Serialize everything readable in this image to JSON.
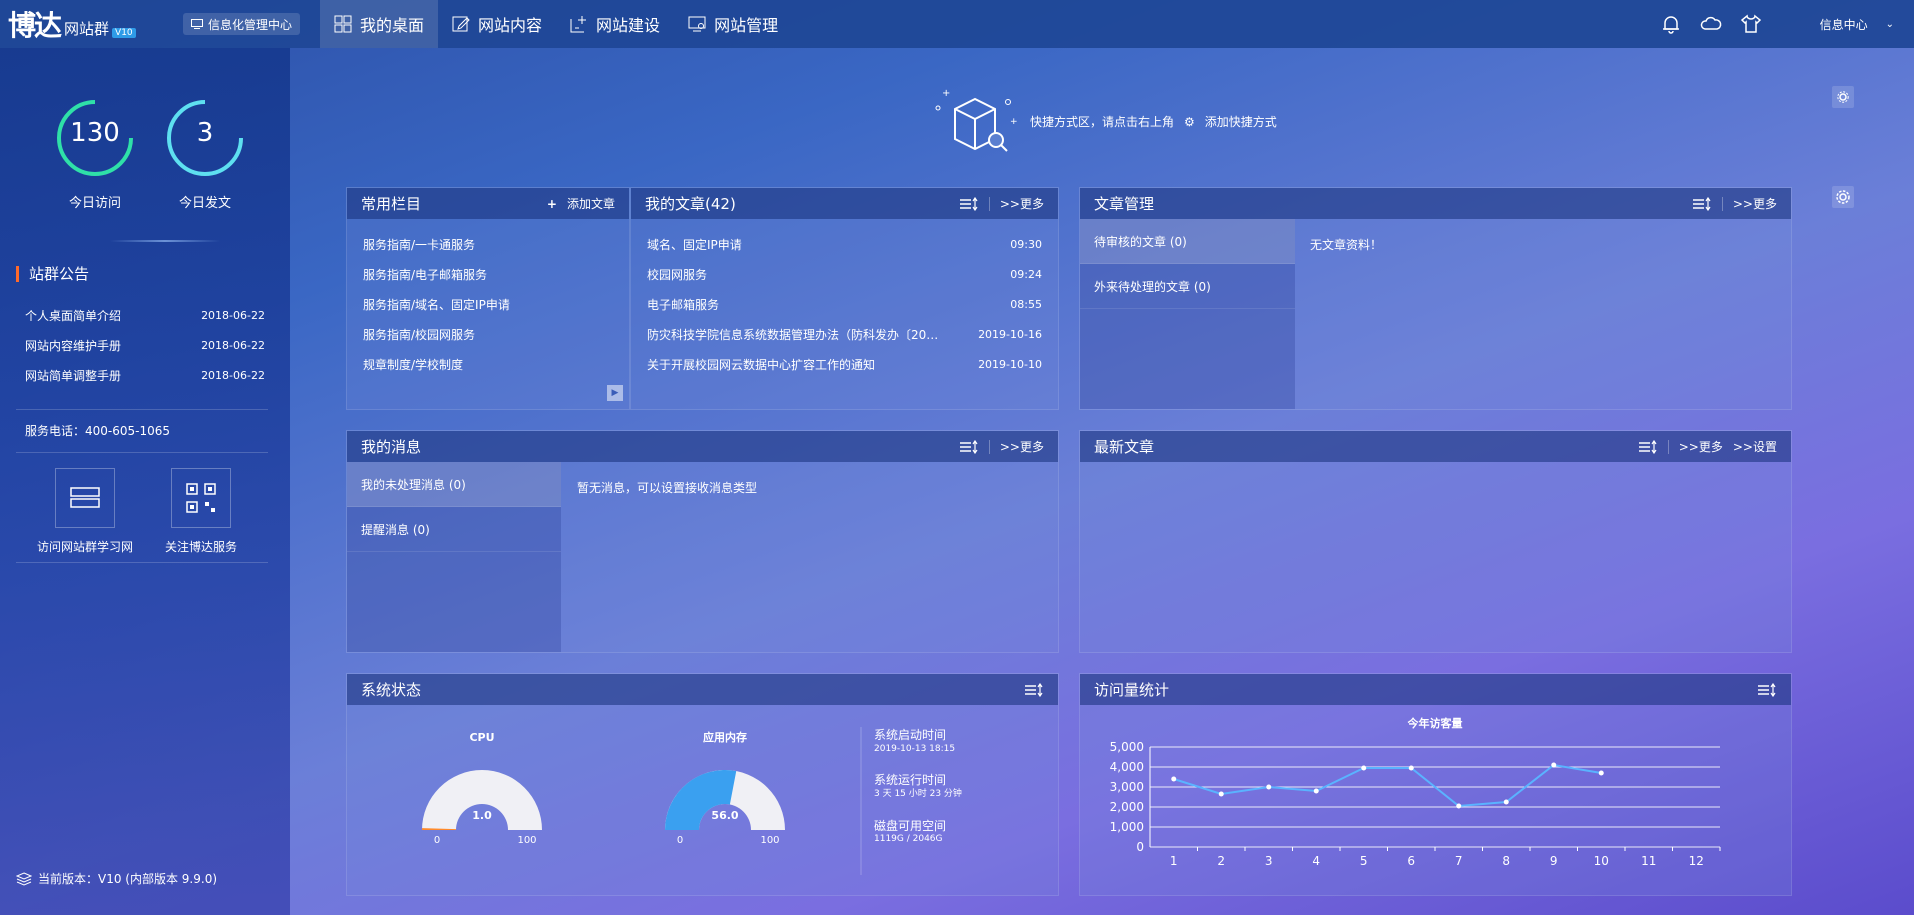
{
  "topbar": {
    "logo_main": "博达",
    "logo_sub": "网站群",
    "logo_version": "V10",
    "mgmt_label": "信息化管理中心",
    "nav": [
      {
        "label": "我的桌面",
        "icon": "grid-icon"
      },
      {
        "label": "网站内容",
        "icon": "edit-icon"
      },
      {
        "label": "网站建设",
        "icon": "build-icon"
      },
      {
        "label": "网站管理",
        "icon": "monitor-icon"
      }
    ],
    "info_center": "信息中心"
  },
  "sidebar": {
    "stats": [
      {
        "value": "130",
        "label": "今日访问"
      },
      {
        "value": "3",
        "label": "今日发文"
      }
    ],
    "notice_title": "站群公告",
    "notices": [
      {
        "title": "个人桌面简单介绍",
        "date": "2018-06-22"
      },
      {
        "title": "网站内容维护手册",
        "date": "2018-06-22"
      },
      {
        "title": "网站简单调整手册",
        "date": "2018-06-22"
      }
    ],
    "phone": "服务电话：400-605-1065",
    "quick_links": [
      {
        "label": "访问网站群学习网"
      },
      {
        "label": "关注博达服务"
      }
    ],
    "version": "当前版本：V10 (内部版本 9.9.0)"
  },
  "shortcut": {
    "text": "快捷方式区，请点击右上角",
    "action": "添加快捷方式"
  },
  "common_columns": {
    "title": "常用栏目",
    "add_label": "添加文章",
    "items": [
      "服务指南/一卡通服务",
      "服务指南/电子邮箱服务",
      "服务指南/域名、固定IP申请",
      "服务指南/校园网服务",
      "规章制度/学校制度"
    ]
  },
  "my_articles": {
    "title": "我的文章(42)",
    "more": ">>更多",
    "items": [
      {
        "title": "域名、固定IP申请",
        "time": "09:30"
      },
      {
        "title": "校园网服务",
        "time": "09:24"
      },
      {
        "title": "电子邮箱服务",
        "time": "08:55"
      },
      {
        "title": "防灾科技学院信息系统数据管理办法（防科发办〔20…",
        "time": "2019-10-16"
      },
      {
        "title": "关于开展校园网云数据中心扩容工作的通知",
        "time": "2019-10-10"
      }
    ]
  },
  "article_mgmt": {
    "title": "文章管理",
    "more": ">>更多",
    "tabs": [
      "待审核的文章 (0)",
      "外来待处理的文章 (0)"
    ],
    "empty": "无文章资料！"
  },
  "my_messages": {
    "title": "我的消息",
    "more": ">>更多",
    "tabs": [
      "我的未处理消息 (0)",
      "提醒消息 (0)"
    ],
    "empty": "暂无消息，可以设置接收消息类型"
  },
  "latest": {
    "title": "最新文章",
    "more": ">>更多",
    "settings": ">>设置"
  },
  "system": {
    "title": "系统状态",
    "cpu_label": "CPU",
    "cpu_value": "1.0",
    "cpu_fraction": 0.01,
    "mem_label": "应用内存",
    "mem_value": "56.0",
    "mem_fraction": 0.56,
    "gauge_min": "0",
    "gauge_max": "100",
    "boot_label": "系统启动时间",
    "boot_value": "2019-10-13 18:15",
    "uptime_label": "系统运行时间",
    "uptime_value": "3 天 15 小时 23 分钟",
    "disk_label": "磁盘可用空间",
    "disk_value": "1119G / 2046G"
  },
  "visits": {
    "title": "访问量统计"
  },
  "chart_data": {
    "type": "line",
    "title": "今年访客量",
    "categories": [
      "1",
      "2",
      "3",
      "4",
      "5",
      "6",
      "7",
      "8",
      "9",
      "10",
      "11",
      "12"
    ],
    "values": [
      3400,
      2650,
      3000,
      2800,
      3950,
      3950,
      2050,
      2250,
      4100,
      3700,
      null,
      null
    ],
    "ylim": [
      0,
      5000
    ],
    "yticks": [
      "0",
      "1,000",
      "2,000",
      "3,000",
      "4,000",
      "5,000"
    ],
    "color": "#5ab3ff",
    "grid": true
  }
}
